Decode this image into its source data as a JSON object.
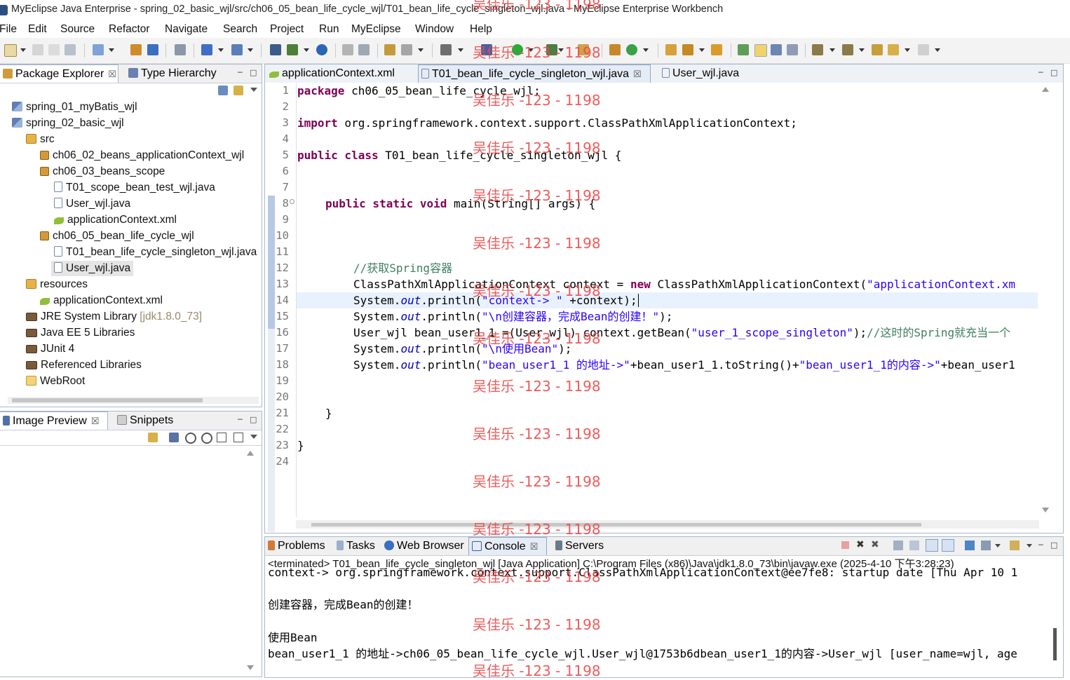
{
  "window": {
    "title": "MyEclipse Java Enterprise - spring_02_basic_wjl/src/ch06_05_bean_life_cycle_wjl/T01_bean_life_cycle_singleton_wjl.java - MyEclipse Enterprise Workbench"
  },
  "menu": [
    "File",
    "Edit",
    "Source",
    "Refactor",
    "Navigate",
    "Search",
    "Project",
    "Run",
    "MyEclipse",
    "Window",
    "Help"
  ],
  "package_explorer": {
    "tabs": [
      {
        "label": "Package Explorer",
        "close": "☒"
      },
      {
        "label": "Type Hierarchy"
      }
    ],
    "tree": [
      {
        "label": "spring_01_myBatis_wjl",
        "icon": "project-icon"
      },
      {
        "label": "spring_02_basic_wjl",
        "icon": "project-icon"
      },
      {
        "label": "src",
        "icon": "source-folder-icon"
      },
      {
        "label": "ch06_02_beans_applicationContext_wjl",
        "icon": "package-icon"
      },
      {
        "label": "ch06_03_beans_scope",
        "icon": "package-icon"
      },
      {
        "label": "T01_scope_bean_test_wjl.java",
        "icon": "java-file-icon"
      },
      {
        "label": "User_wjl.java",
        "icon": "java-file-icon"
      },
      {
        "label": "applicationContext.xml",
        "icon": "xml-file-icon"
      },
      {
        "label": "ch06_05_bean_life_cycle_wjl",
        "icon": "package-icon"
      },
      {
        "label": "T01_bean_life_cycle_singleton_wjl.java",
        "icon": "java-file-icon"
      },
      {
        "label": "User_wjl.java",
        "icon": "java-file-icon"
      },
      {
        "label": "resources",
        "icon": "source-folder-icon"
      },
      {
        "label": "applicationContext.xml",
        "icon": "xml-file-icon"
      },
      {
        "label": "JRE System Library",
        "suffix": "[jdk1.8.0_73]",
        "icon": "library-icon"
      },
      {
        "label": "Java EE 5 Libraries",
        "icon": "library-icon"
      },
      {
        "label": "JUnit 4",
        "icon": "library-icon"
      },
      {
        "label": "Referenced Libraries",
        "icon": "library-icon"
      },
      {
        "label": "WebRoot",
        "icon": "folder-icon"
      }
    ]
  },
  "image_preview": {
    "tabs": [
      {
        "label": "Image Preview",
        "close": "☒"
      },
      {
        "label": "Snippets"
      }
    ]
  },
  "editor": {
    "tabs": [
      {
        "label": "applicationContext.xml"
      },
      {
        "label": "T01_bean_life_cycle_singleton_wjl.java",
        "close": "☒"
      },
      {
        "label": "User_wjl.java"
      }
    ],
    "line_numbers": [
      "1",
      "2",
      "3",
      "4",
      "5",
      "6",
      "7",
      "8",
      "9",
      "10",
      "11",
      "12",
      "13",
      "14",
      "15",
      "16",
      "17",
      "18",
      "19",
      "20",
      "21",
      "22",
      "23",
      "24"
    ],
    "code": {
      "l1_kw": "package",
      "l1_rest": " ch06_05_bean_life_cycle_wjl;",
      "l3_kw": "import",
      "l3_rest": " org.springframework.context.support.ClassPathXmlApplicationContext;",
      "l5_kw": "public class",
      "l5_rest": " T01_bean_life_cycle_singleton_wjl {",
      "l8_kw": "public static void",
      "l8_rest": " main(String[] args) {",
      "l12_cmt": "//获取Spring容器",
      "l13_a": "ClassPathXmlApplicationContext context = ",
      "l13_kw": "new",
      "l13_b": " ClassPathXmlApplicationContext(",
      "l13_str": "\"applicationContext.xm",
      "l14_a": "System.",
      "l14_fld": "out",
      "l14_b": ".println(",
      "l14_str": "\"context-> \"",
      "l14_c": " +context);",
      "l15_a": "System.",
      "l15_fld": "out",
      "l15_b": ".println(",
      "l15_str": "\"\\n创建容器，完成Bean的创建！\"",
      "l15_c": ");",
      "l16_a": "User_wjl bean_user1_1 =(User_wjl) context.getBean(",
      "l16_str": "\"user_1_scope_singleton\"",
      "l16_b": ");",
      "l16_cmt": "//这时的Spring就充当一个",
      "l17_a": "System.",
      "l17_fld": "out",
      "l17_b": ".println(",
      "l17_str": "\"\\n使用Bean\"",
      "l17_c": ");",
      "l18_a": "System.",
      "l18_fld": "out",
      "l18_b": ".println(",
      "l18_str1": "\"bean_user1_1 的地址->\"",
      "l18_c": "+bean_user1_1.toString()+",
      "l18_str2": "\"bean_user1_1的内容->\"",
      "l18_d": "+bean_user1",
      "l21": "}",
      "l23": "}"
    }
  },
  "console_view": {
    "tabs": [
      {
        "label": "Problems"
      },
      {
        "label": "Tasks"
      },
      {
        "label": "Web Browser"
      },
      {
        "label": "Console",
        "close": "☒"
      },
      {
        "label": "Servers"
      }
    ],
    "header": "<terminated> T01_bean_life_cycle_singleton_wjl [Java Application] C:\\Program Files (x86)\\Java\\jdk1.8.0_73\\bin\\javaw.exe (2025-4-10 下午3:28:23)",
    "lines": [
      "context-> org.springframework.context.support.ClassPathXmlApplicationContext@ee7fe8: startup date [Thu Apr 10 1",
      "",
      "创建容器，完成Bean的创建！",
      "",
      "使用Bean",
      "bean_user1_1 的地址->ch06_05_bean_life_cycle_wjl.User_wjl@1753b6dbean_user1_1的内容->User_wjl [user_name=wjl, age"
    ]
  },
  "watermark": "吴佳乐 -123 - 1198",
  "colors": {
    "keyword": "#7f0055",
    "string": "#2a00ff",
    "comment": "#3f7f5f",
    "field": "#0000c0",
    "watermark": "#ee4a4a"
  }
}
